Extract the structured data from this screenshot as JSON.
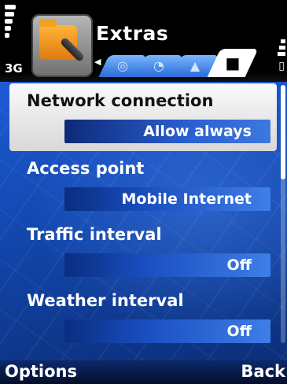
{
  "status": {
    "network": "3G"
  },
  "header": {
    "title": "Extras",
    "tabs": [
      {
        "icon": "target-icon"
      },
      {
        "icon": "gauge-icon"
      },
      {
        "icon": "bell-icon"
      },
      {
        "icon": "folder-icon",
        "active": true
      }
    ]
  },
  "settings": [
    {
      "label": "Network connection",
      "value": "Allow always",
      "selected": true
    },
    {
      "label": "Access point",
      "value": "Mobile Internet"
    },
    {
      "label": "Traffic interval",
      "value": "Off"
    },
    {
      "label": "Weather interval",
      "value": "Off"
    }
  ],
  "softkeys": {
    "left": "Options",
    "right": "Back"
  }
}
